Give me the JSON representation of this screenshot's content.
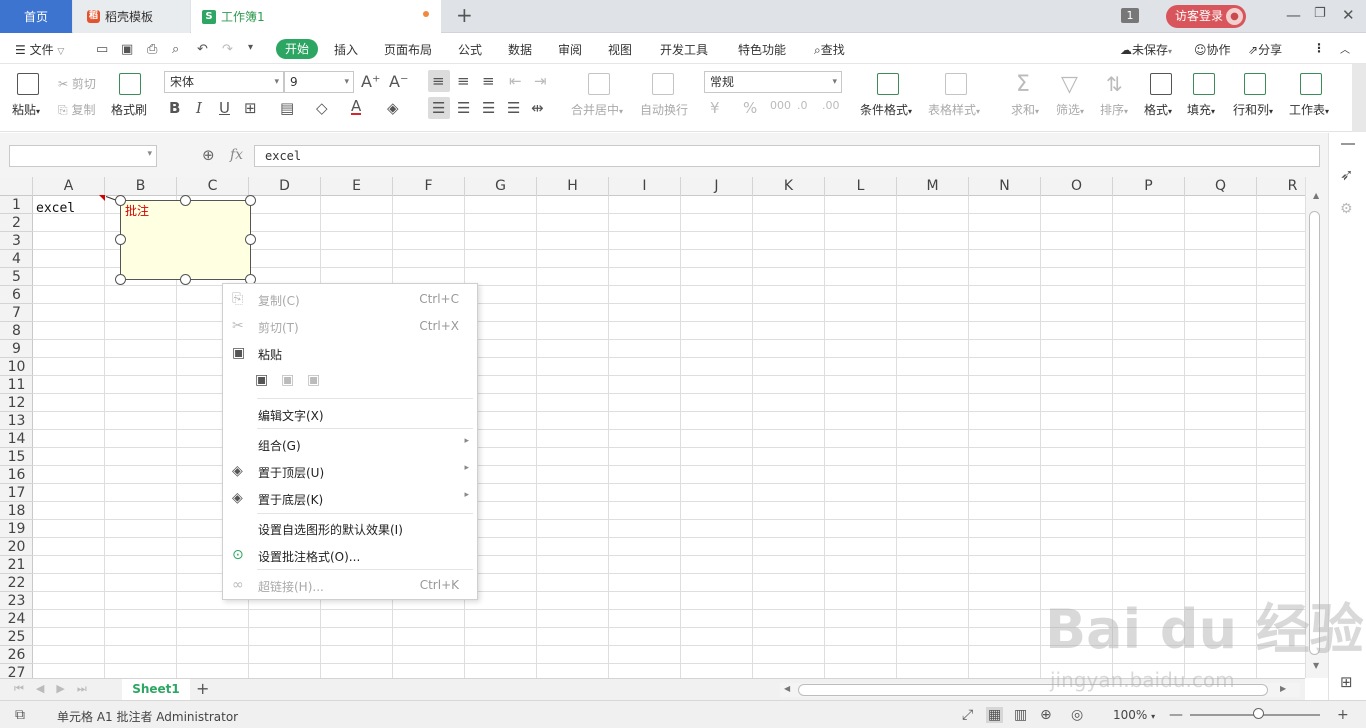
{
  "tabs": {
    "home": "首页",
    "template": "稻壳模板",
    "template_icon": "稻",
    "doc": "工作簿1",
    "doc_icon": "S",
    "window_count": "1",
    "login": "访客登录"
  },
  "menubar": {
    "file": "文件",
    "start": "开始",
    "items": [
      "插入",
      "页面布局",
      "公式",
      "数据",
      "审阅",
      "视图",
      "开发工具",
      "特色功能",
      "查找"
    ],
    "unsaved": "未保存",
    "collab": "协作",
    "share": "分享"
  },
  "ribbon": {
    "paste": "粘贴",
    "cut": "剪切",
    "copy": "复制",
    "format_painter": "格式刷",
    "font_name": "宋体",
    "font_size": "9",
    "merge_center": "合并居中",
    "wrap_text": "自动换行",
    "number_format": "常规",
    "cond_format": "条件格式",
    "table_style": "表格样式",
    "sum": "求和",
    "filter": "筛选",
    "sort": "排序",
    "format": "格式",
    "fill": "填充",
    "row_col": "行和列",
    "worksheet": "工作表"
  },
  "formula": {
    "value": "excel"
  },
  "grid": {
    "columns": [
      "A",
      "B",
      "C",
      "D",
      "E",
      "F",
      "G",
      "H",
      "I",
      "J",
      "K",
      "L",
      "M",
      "N",
      "O",
      "P",
      "Q",
      "R"
    ],
    "rows": [
      "1",
      "2",
      "3",
      "4",
      "5",
      "6",
      "7",
      "8",
      "9",
      "10",
      "11",
      "12",
      "13",
      "14",
      "15",
      "16",
      "17",
      "18",
      "19",
      "20",
      "21",
      "22",
      "23",
      "24",
      "25",
      "26",
      "27"
    ],
    "a1": "excel",
    "comment": "批注"
  },
  "context_menu": [
    {
      "label": "复制(C)",
      "shortcut": "Ctrl+C",
      "disabled": true,
      "icon": "copy-icon"
    },
    {
      "label": "剪切(T)",
      "shortcut": "Ctrl+X",
      "disabled": true,
      "icon": "scissors-icon"
    },
    {
      "label": "粘贴",
      "shortcut": "",
      "disabled": false,
      "icon": "paste-icon"
    },
    {
      "label": "编辑文字(X)",
      "shortcut": "",
      "disabled": false,
      "icon": ""
    },
    {
      "label": "组合(G)",
      "shortcut": "",
      "disabled": false,
      "icon": "",
      "submenu": true
    },
    {
      "label": "置于顶层(U)",
      "shortcut": "",
      "disabled": false,
      "icon": "bring-front-icon",
      "submenu": true
    },
    {
      "label": "置于底层(K)",
      "shortcut": "",
      "disabled": false,
      "icon": "send-back-icon",
      "submenu": true
    },
    {
      "label": "设置自选图形的默认效果(I)",
      "shortcut": "",
      "disabled": false,
      "icon": ""
    },
    {
      "label": "设置批注格式(O)...",
      "shortcut": "",
      "disabled": false,
      "icon": "comment-format-icon"
    },
    {
      "label": "超链接(H)...",
      "shortcut": "Ctrl+K",
      "disabled": true,
      "icon": "link-icon"
    }
  ],
  "sheet": {
    "name": "Sheet1"
  },
  "status": {
    "text": "单元格 A1 批注者 Administrator",
    "zoom": "100%"
  },
  "watermark": {
    "main": "Bai du 经验",
    "sub": "jingyan.baidu.com"
  }
}
